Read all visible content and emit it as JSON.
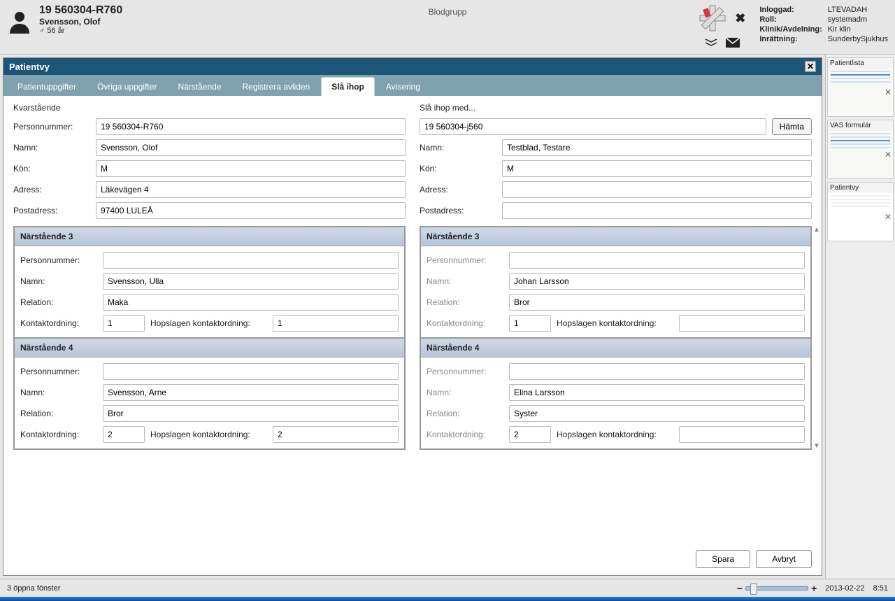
{
  "header": {
    "patient_id": "19 560304-R760",
    "patient_name": "Svensson, Olof",
    "patient_age": "♂ 56 år",
    "bloodgroup_label": "Blodgrupp",
    "login": {
      "labels": {
        "user": "Inloggad:",
        "role": "Roll:",
        "clinic": "Klinik/Avdelning:",
        "facility": "Inrättning:"
      },
      "user": "LTEVADAH",
      "role": "systemadm",
      "clinic": "Kir klin",
      "facility": "SunderbySjukhus"
    }
  },
  "window": {
    "title": "Patientvy"
  },
  "tabs": {
    "items": [
      {
        "label": "Patientuppgifter"
      },
      {
        "label": "Övriga uppgifter"
      },
      {
        "label": "Närstående"
      },
      {
        "label": "Registrera avliden"
      },
      {
        "label": "Slå ihop"
      },
      {
        "label": "Avisering"
      }
    ],
    "active_index": 4
  },
  "merge_form": {
    "left_heading": "Kvarstående",
    "right_heading": "Slå ihop med...",
    "labels": {
      "personnummer": "Personnummer:",
      "namn": "Namn:",
      "kon": "Kön:",
      "adress": "Adress:",
      "postadress": "Postadress:"
    },
    "left": {
      "personnummer": "19 560304-R760",
      "namn": "Svensson, Olof",
      "kon": "M",
      "adress": "Läkevägen 4",
      "postadress": "97400 LULEÅ"
    },
    "right": {
      "personnummer": "19 560304-j560",
      "namn": "Testblad, Testare",
      "kon": "M",
      "adress": "",
      "postadress": ""
    },
    "fetch_button": "Hämta"
  },
  "relatives": {
    "labels": {
      "personnummer": "Personnummer:",
      "namn": "Namn:",
      "relation": "Relation:",
      "kontaktordning": "Kontaktordning:",
      "hopslagen": "Hopslagen kontaktordning:"
    },
    "left": [
      {
        "title": "Närstående 3",
        "personnummer": "",
        "namn": "Svensson, Ulla",
        "relation": "Maka",
        "kontaktordning": "1",
        "hopslagen": "1"
      },
      {
        "title": "Närstående 4",
        "personnummer": "",
        "namn": "Svensson, Arne",
        "relation": "Bror",
        "kontaktordning": "2",
        "hopslagen": "2"
      }
    ],
    "right": [
      {
        "title": "Närstående 3",
        "personnummer": "",
        "namn": "Johan Larsson",
        "relation": "Bror",
        "kontaktordning": "1",
        "hopslagen": ""
      },
      {
        "title": "Närstående 4",
        "personnummer": "",
        "namn": "Elina Larsson",
        "relation": "Syster",
        "kontaktordning": "2",
        "hopslagen": ""
      }
    ]
  },
  "buttons": {
    "save": "Spara",
    "cancel": "Avbryt"
  },
  "sidebar": {
    "items": [
      {
        "title": "Patientlista"
      },
      {
        "title": "VAS formulär"
      },
      {
        "title": "Patientvy"
      }
    ]
  },
  "statusbar": {
    "open_windows": "3 öppna fönster",
    "date": "2013-02-22",
    "time": "8:51"
  }
}
